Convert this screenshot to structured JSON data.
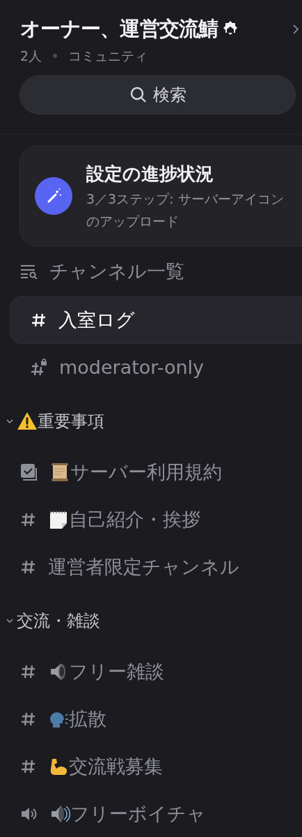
{
  "server": {
    "name": "オーナー、運営交流鯖",
    "members": "2人",
    "type": "コミュニティ"
  },
  "search": {
    "label": "検索"
  },
  "setup": {
    "title": "設定の進捗状況",
    "detail": "3／3ステップ: サーバーアイコンのアップロード"
  },
  "channel_list": {
    "label": "チャンネル一覧"
  },
  "channels": [
    {
      "kind": "text",
      "name": "入室ログ",
      "selected": true
    },
    {
      "kind": "private",
      "name": "moderator-only",
      "selected": false
    }
  ],
  "categories": [
    {
      "name": "重要事項",
      "emoji": {
        "kind": "warning"
      },
      "expanded": true,
      "channels": [
        {
          "kind": "rules",
          "emoji": {
            "kind": "scroll"
          },
          "name": "サーバー利用規約",
          "selected": false
        },
        {
          "kind": "text",
          "emoji": {
            "kind": "notepad"
          },
          "name": "自己紹介・挨拶",
          "selected": false
        },
        {
          "kind": "text",
          "name": "運営者限定チャンネル",
          "selected": false
        }
      ]
    },
    {
      "name": "交流・雑談",
      "expanded": true,
      "channels": [
        {
          "kind": "text",
          "emoji": {
            "kind": "speaker"
          },
          "name": "フリー雑談",
          "selected": false
        },
        {
          "kind": "text",
          "emoji": {
            "kind": "speaking"
          },
          "name": "拡散",
          "selected": false
        },
        {
          "kind": "text",
          "emoji": {
            "kind": "arm"
          },
          "name": "交流戦募集",
          "selected": false
        },
        {
          "kind": "voice",
          "emoji": {
            "kind": "loudspeaker"
          },
          "name": "フリーボイチャ",
          "selected": false
        }
      ]
    }
  ]
}
